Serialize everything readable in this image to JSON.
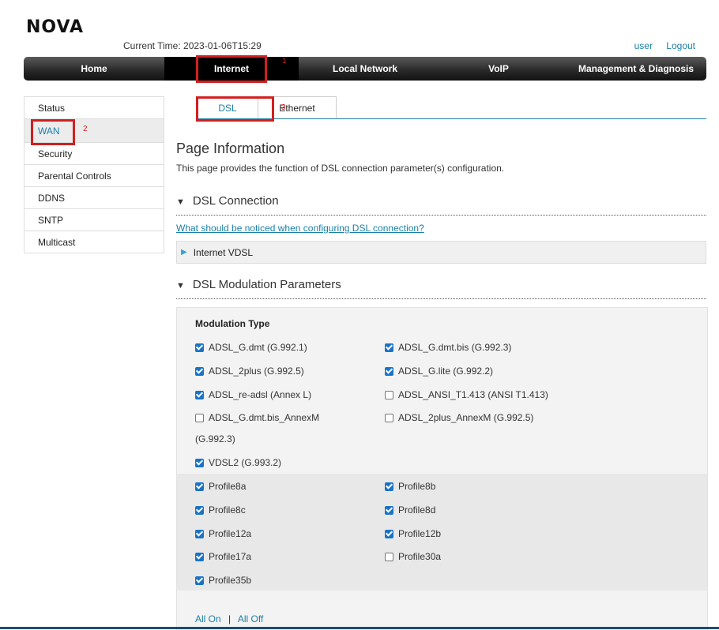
{
  "header": {
    "logo": "NOVA",
    "current_time": "Current Time: 2023-01-06T15:29",
    "user_link": "user",
    "logout_link": "Logout"
  },
  "nav": {
    "items": [
      "Home",
      "Internet",
      "Local Network",
      "VoIP",
      "Management & Diagnosis"
    ],
    "active": "Internet"
  },
  "annotations": {
    "nav_marker": "1",
    "sidebar_marker": "2",
    "tab_marker": "3"
  },
  "sidebar": {
    "items": [
      "Status",
      "WAN",
      "Security",
      "Parental Controls",
      "DDNS",
      "SNTP",
      "Multicast"
    ],
    "active": "WAN"
  },
  "tabs": {
    "items": [
      "DSL",
      "Ethernet"
    ],
    "active": "DSL"
  },
  "page": {
    "title": "Page Information",
    "description": "This page provides the function of DSL connection parameter(s) configuration."
  },
  "dsl_connection": {
    "heading": "DSL Connection",
    "help_link": "What should be noticed when configuring DSL connection?",
    "entry": "Internet VDSL"
  },
  "modulation": {
    "heading": "DSL Modulation Parameters",
    "type_label": "Modulation Type",
    "types": [
      {
        "label": "ADSL_G.dmt (G.992.1)",
        "checked": true
      },
      {
        "label": "ADSL_G.dmt.bis (G.992.3)",
        "checked": true
      },
      {
        "label": "ADSL_2plus (G.992.5)",
        "checked": true
      },
      {
        "label": "ADSL_G.lite (G.992.2)",
        "checked": true
      },
      {
        "label": "ADSL_re-adsl (Annex L)",
        "checked": true
      },
      {
        "label": "ADSL_ANSI_T1.413 (ANSI T1.413)",
        "checked": false
      },
      {
        "label": "ADSL_G.dmt.bis_AnnexM",
        "label_cont": "(G.992.3)",
        "checked": false
      },
      {
        "label": "ADSL_2plus_AnnexM (G.992.5)",
        "checked": false
      },
      {
        "label": "VDSL2 (G.993.2)",
        "checked": true
      }
    ],
    "profiles": [
      {
        "label": "Profile8a",
        "checked": true
      },
      {
        "label": "Profile8b",
        "checked": true
      },
      {
        "label": "Profile8c",
        "checked": true
      },
      {
        "label": "Profile8d",
        "checked": true
      },
      {
        "label": "Profile12a",
        "checked": true
      },
      {
        "label": "Profile12b",
        "checked": true
      },
      {
        "label": "Profile17a",
        "checked": true
      },
      {
        "label": "Profile30a",
        "checked": false
      },
      {
        "label": "Profile35b",
        "checked": true
      }
    ],
    "all_on": "All On",
    "separator": "|",
    "all_off": "All Off"
  }
}
